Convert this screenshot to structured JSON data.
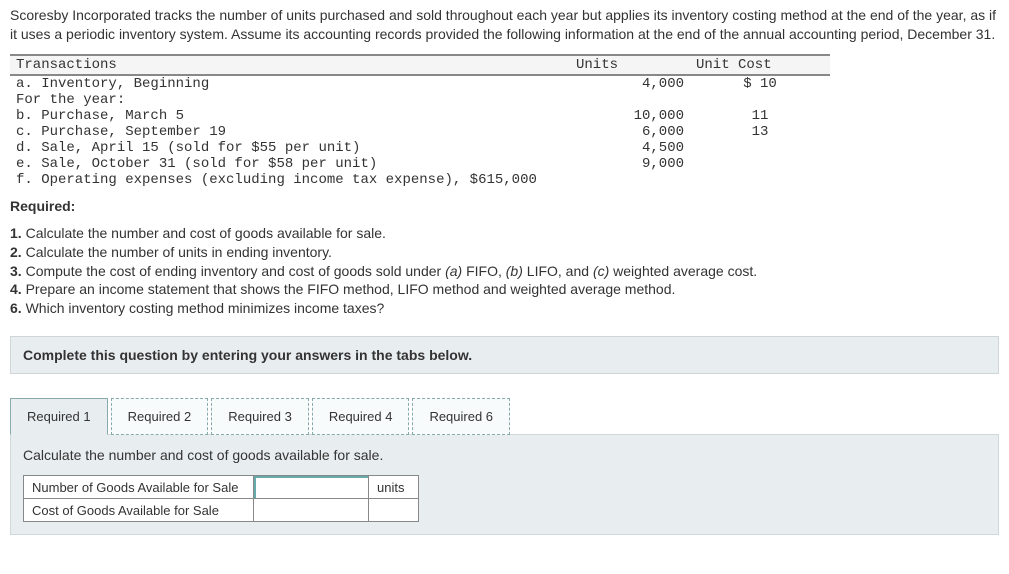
{
  "intro": "Scoresby Incorporated tracks the number of units purchased and sold throughout each year but applies its inventory costing method at the end of the year, as if it uses a periodic inventory system. Assume its accounting records provided the following information at the end of the annual accounting period, December 31.",
  "tx_headers": {
    "c0": "Transactions",
    "c1": "Units",
    "c2": "Unit Cost"
  },
  "tx": [
    {
      "label": "a. Inventory, Beginning",
      "units": "4,000",
      "cost": "$ 10"
    },
    {
      "label": "For the year:",
      "units": "",
      "cost": ""
    },
    {
      "label": "b. Purchase, March 5",
      "units": "10,000",
      "cost": "11"
    },
    {
      "label": "c. Purchase, September 19",
      "units": "6,000",
      "cost": "13"
    },
    {
      "label": "d. Sale, April 15 (sold for $55 per unit)",
      "units": "4,500",
      "cost": ""
    },
    {
      "label": "e. Sale, October 31 (sold for $58 per unit)",
      "units": "9,000",
      "cost": ""
    },
    {
      "label": "f. Operating expenses (excluding income tax expense), $615,000",
      "units": "",
      "cost": ""
    }
  ],
  "required_hdr": "Required:",
  "req1_a": "1. ",
  "req1_b": "Calculate the number and cost of goods available for sale.",
  "req2_a": "2. ",
  "req2_b": "Calculate the number of units in ending inventory.",
  "req3_a": "3. ",
  "req3_b": "Compute the cost of ending inventory and cost of goods sold under ",
  "req3_c": "(a)",
  "req3_d": " FIFO, ",
  "req3_e": "(b)",
  "req3_f": " LIFO, and ",
  "req3_g": "(c)",
  "req3_h": " weighted average cost.",
  "req4_a": "4. ",
  "req4_b": "Prepare an income statement that shows the FIFO method, LIFO method and weighted average method.",
  "req6_a": "6. ",
  "req6_b": "Which inventory costing method minimizes income taxes?",
  "complete_text": "Complete this question by entering your answers in the tabs below.",
  "tabs": {
    "t1": "Required 1",
    "t2": "Required 2",
    "t3": "Required 3",
    "t4": "Required 4",
    "t6": "Required 6"
  },
  "prompt": "Calculate the number and cost of goods available for sale.",
  "ans": {
    "row1_label": "Number of Goods Available for Sale",
    "row1_unit": "units",
    "row2_label": "Cost of Goods Available for Sale"
  }
}
